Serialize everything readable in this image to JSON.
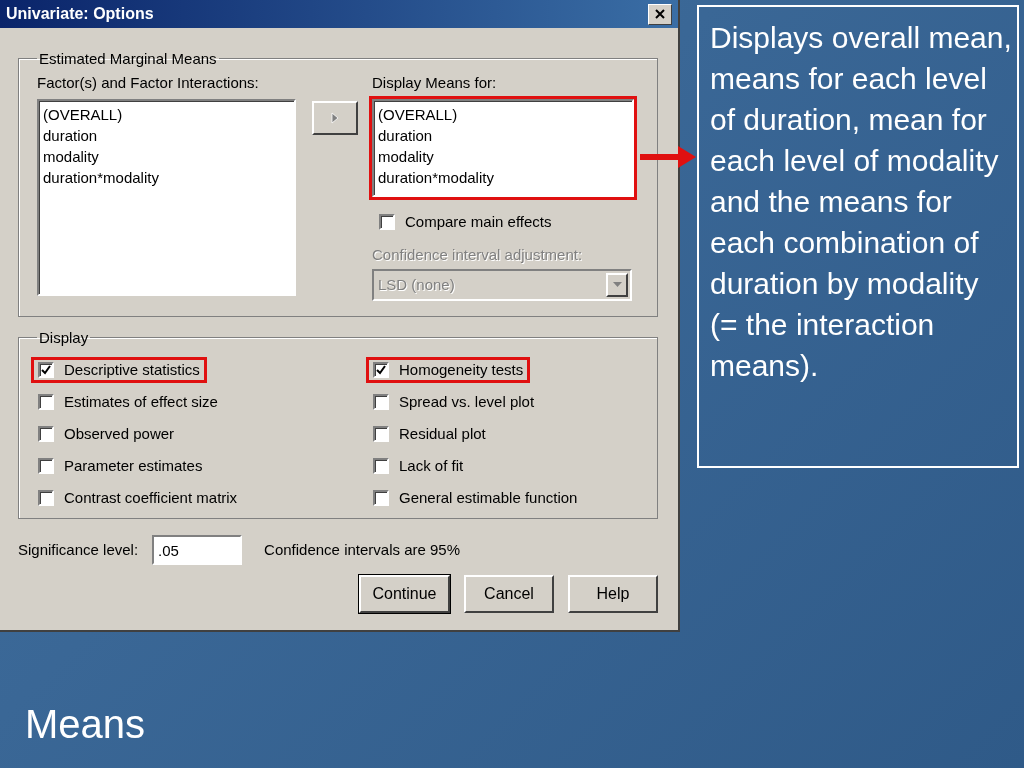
{
  "window": {
    "title": "Univariate: Options"
  },
  "estimated_marginal_means": {
    "title": "Estimated Marginal Means",
    "factors_label": "Factor(s) and Factor Interactions:",
    "factors": [
      "(OVERALL)",
      "duration",
      "modality",
      "duration*modality"
    ],
    "display_means_label": "Display Means for:",
    "display_means": [
      "(OVERALL)",
      "duration",
      "modality",
      "duration*modality"
    ],
    "display_means_highlighted": true,
    "compare_main_effects": {
      "label": "Compare main effects",
      "checked": false
    },
    "ci_adjustment": {
      "label": "Confidence interval adjustment:",
      "value": "LSD (none)",
      "disabled": true
    }
  },
  "display": {
    "title": "Display",
    "left_options": [
      {
        "label": "Descriptive statistics",
        "checked": true,
        "highlighted": true
      },
      {
        "label": "Estimates of effect size",
        "checked": false,
        "highlighted": false
      },
      {
        "label": "Observed power",
        "checked": false,
        "highlighted": false
      },
      {
        "label": "Parameter estimates",
        "checked": false,
        "highlighted": false
      },
      {
        "label": "Contrast coefficient matrix",
        "checked": false,
        "highlighted": false
      }
    ],
    "right_options": [
      {
        "label": "Homogeneity tests",
        "checked": true,
        "highlighted": true
      },
      {
        "label": "Spread vs. level plot",
        "checked": false,
        "highlighted": false
      },
      {
        "label": "Residual plot",
        "checked": false,
        "highlighted": false
      },
      {
        "label": "Lack of fit",
        "checked": false,
        "highlighted": false
      },
      {
        "label": "General estimable function",
        "checked": false,
        "highlighted": false
      }
    ]
  },
  "significance": {
    "label": "Significance level:",
    "value": ".05"
  },
  "confidence_note": "Confidence intervals are 95%",
  "buttons": [
    {
      "label": "Continue",
      "default": true
    },
    {
      "label": "Cancel",
      "default": false
    },
    {
      "label": "Help",
      "default": false
    }
  ],
  "callout": {
    "text": "Displays overall mean, means for each level of duration, mean for each level of modality and the means for each combination of duration by modality (= the interaction means)."
  },
  "slide_title": "Means"
}
